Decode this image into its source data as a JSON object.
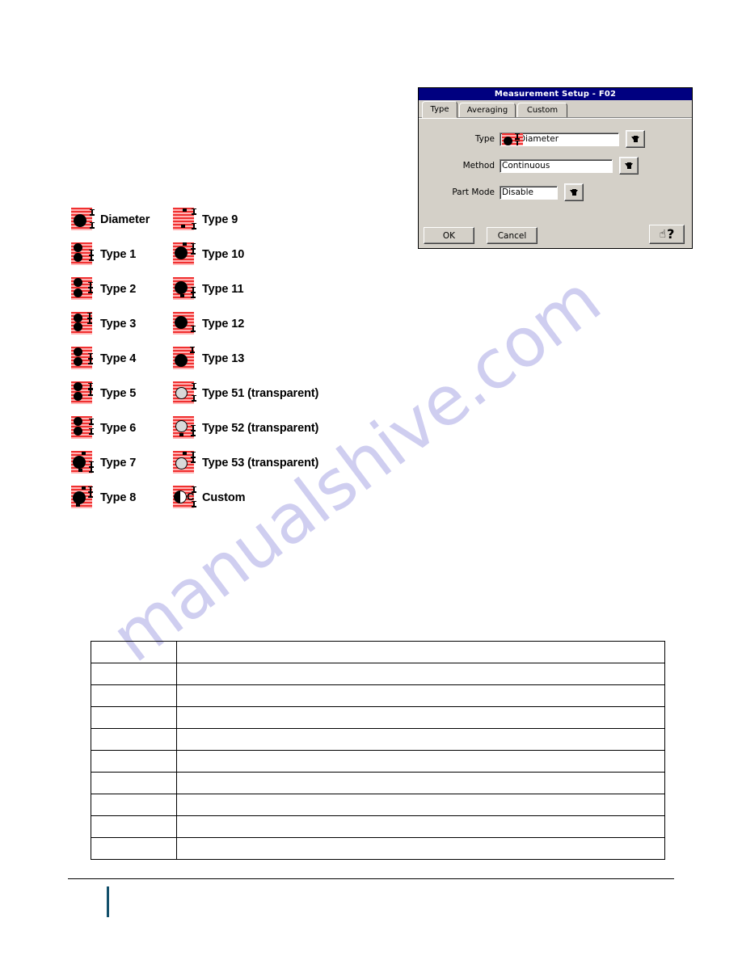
{
  "document": {
    "watermark_text": "manualshive.com",
    "watermark_color": "#cfcef0"
  },
  "legend": {
    "icon_colors": {
      "stripe_dark": "#f03030",
      "stripe_light": "#ffb3b3",
      "solid_dot": "#000000",
      "transparent_dot": "#d9d9d9"
    },
    "columns": [
      {
        "name": "left-column",
        "items": [
          {
            "label": "Diameter",
            "icon": "measurement-type-diameter-icon",
            "dots": 1,
            "dot_style": "solid"
          },
          {
            "label": "Type 1",
            "icon": "measurement-type-1-icon",
            "dots": 2,
            "dot_style": "solid"
          },
          {
            "label": "Type 2",
            "icon": "measurement-type-2-icon",
            "dots": 2,
            "dot_style": "solid"
          },
          {
            "label": "Type 3",
            "icon": "measurement-type-3-icon",
            "dots": 2,
            "dot_style": "solid"
          },
          {
            "label": "Type 4",
            "icon": "measurement-type-4-icon",
            "dots": 2,
            "dot_style": "solid"
          },
          {
            "label": "Type 5",
            "icon": "measurement-type-5-icon",
            "dots": 2,
            "dot_style": "solid"
          },
          {
            "label": "Type 6",
            "icon": "measurement-type-6-icon",
            "dots": 2,
            "dot_style": "solid"
          },
          {
            "label": "Type 7",
            "icon": "measurement-type-7-icon",
            "dots": 1,
            "dot_style": "solid"
          },
          {
            "label": "Type 8",
            "icon": "measurement-type-8-icon",
            "dots": 1,
            "dot_style": "solid"
          }
        ]
      },
      {
        "name": "right-column",
        "items": [
          {
            "label": "Type 9",
            "icon": "measurement-type-9-icon",
            "dots": 0,
            "dot_style": "none"
          },
          {
            "label": "Type 10",
            "icon": "measurement-type-10-icon",
            "dots": 1,
            "dot_style": "solid"
          },
          {
            "label": "Type 11",
            "icon": "measurement-type-11-icon",
            "dots": 1,
            "dot_style": "solid"
          },
          {
            "label": "Type 12",
            "icon": "measurement-type-12-icon",
            "dots": 1,
            "dot_style": "solid"
          },
          {
            "label": "Type 13",
            "icon": "measurement-type-13-icon",
            "dots": 1,
            "dot_style": "solid"
          },
          {
            "label": "Type 51 (transparent)",
            "icon": "measurement-type-51-icon",
            "dots": 1,
            "dot_style": "hollow"
          },
          {
            "label": "Type 52 (transparent)",
            "icon": "measurement-type-52-icon",
            "dots": 1,
            "dot_style": "hollow"
          },
          {
            "label": "Type 53 (transparent)",
            "icon": "measurement-type-53-icon",
            "dots": 1,
            "dot_style": "hollow"
          },
          {
            "label": "Custom",
            "icon": "measurement-type-custom-icon",
            "dots": 1,
            "dot_style": "half",
            "extra_glyph": "C"
          }
        ]
      }
    ]
  },
  "dialog": {
    "title": "Measurement Setup - F02",
    "title_bar_color": "#000080",
    "face_color": "#d4d0c8",
    "tabs": [
      {
        "label": "Type",
        "active": true
      },
      {
        "label": "Averaging",
        "active": false
      },
      {
        "label": "Custom",
        "active": false
      }
    ],
    "fields": [
      {
        "label": "Type",
        "value": "Diameter",
        "has_icon": true,
        "has_dropdown": true
      },
      {
        "label": "Method",
        "value": "Continuous",
        "has_icon": false,
        "has_dropdown": true
      },
      {
        "label": "Part Mode",
        "value": "Disable",
        "has_icon": false,
        "has_dropdown": true
      }
    ],
    "buttons": {
      "ok": "OK",
      "cancel": "Cancel",
      "help_icon": "hand-pointer-question-icon",
      "help_glyph": "?"
    }
  },
  "table": {
    "rows": 10,
    "columns": 2,
    "cells": [
      [
        "",
        ""
      ],
      [
        "",
        ""
      ],
      [
        "",
        ""
      ],
      [
        "",
        ""
      ],
      [
        "",
        ""
      ],
      [
        "",
        ""
      ],
      [
        "",
        ""
      ],
      [
        "",
        ""
      ],
      [
        "",
        ""
      ],
      [
        "",
        ""
      ]
    ]
  }
}
